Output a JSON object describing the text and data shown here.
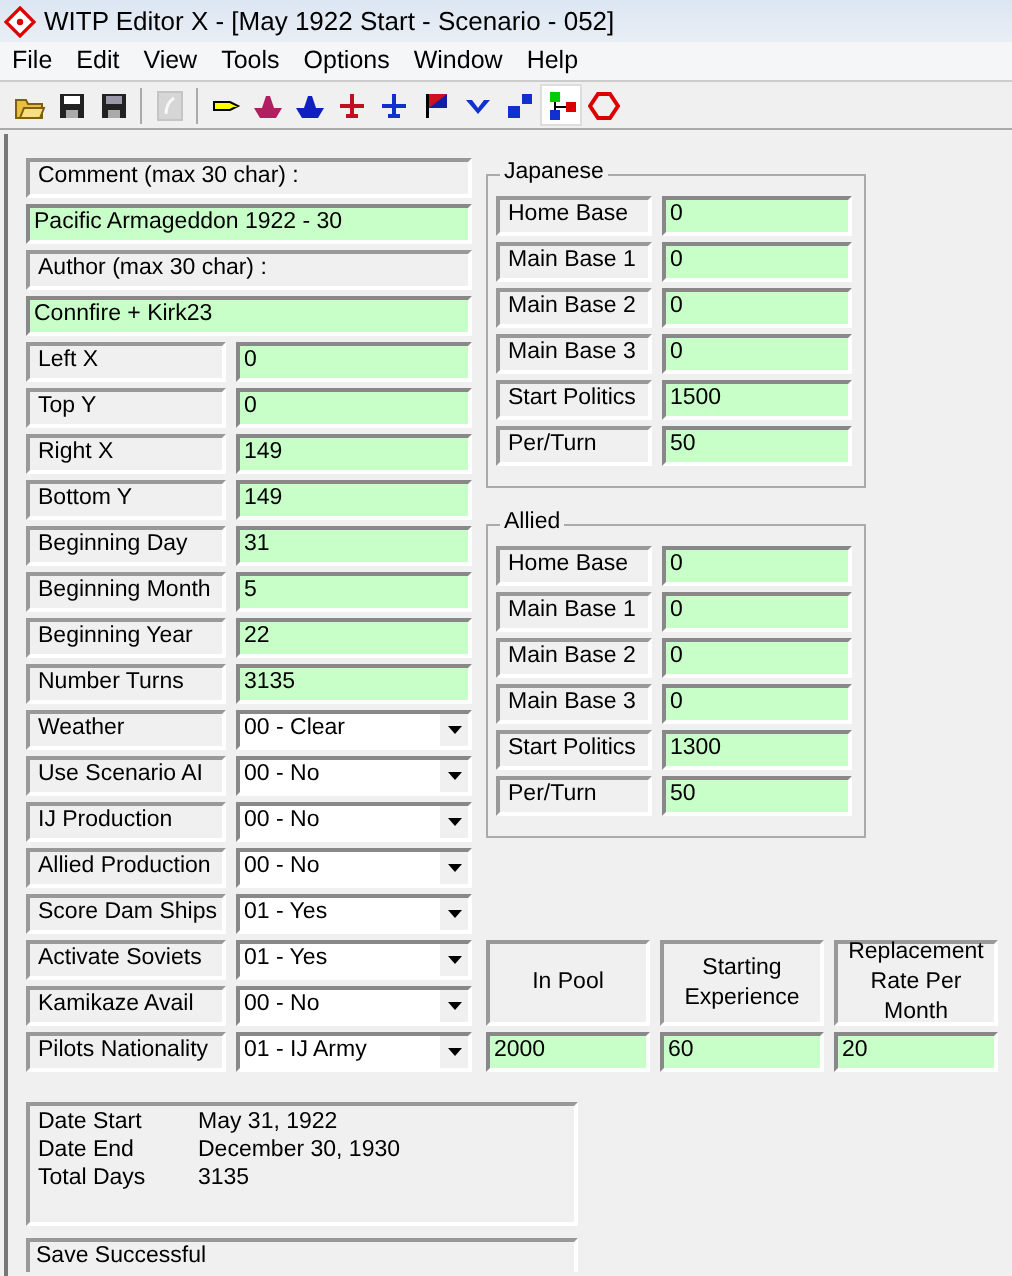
{
  "window": {
    "title": "WITP Editor X - [May 1922 Start - Scenario - 052]"
  },
  "menu": [
    "File",
    "Edit",
    "View",
    "Tools",
    "Options",
    "Window",
    "Help"
  ],
  "toolbar": [
    {
      "disabled": false,
      "pressed": false
    },
    {
      "disabled": false,
      "pressed": false
    },
    {
      "disabled": false,
      "pressed": false
    },
    {
      "disabled": true,
      "pressed": false
    },
    {
      "disabled": false,
      "pressed": false
    },
    {
      "disabled": false,
      "pressed": false
    },
    {
      "disabled": false,
      "pressed": false
    },
    {
      "disabled": false,
      "pressed": false
    },
    {
      "disabled": false,
      "pressed": false
    },
    {
      "disabled": false,
      "pressed": false
    },
    {
      "disabled": false,
      "pressed": false
    },
    {
      "disabled": false,
      "pressed": false
    },
    {
      "disabled": false,
      "pressed": true
    },
    {
      "disabled": false,
      "pressed": false
    }
  ],
  "comment": {
    "label": "Comment (max 30 char) :",
    "value": "Pacific Armageddon 1922 - 30"
  },
  "author": {
    "label": "Author (max 30 char) :",
    "value": "Connfire + Kirk23"
  },
  "fields": [
    {
      "label": "Left X",
      "value": "0"
    },
    {
      "label": "Top Y",
      "value": "0"
    },
    {
      "label": "Right X",
      "value": "149"
    },
    {
      "label": "Bottom Y",
      "value": "149"
    },
    {
      "label": "Beginning Day",
      "value": "31"
    },
    {
      "label": "Beginning Month",
      "value": "5"
    },
    {
      "label": "Beginning Year",
      "value": "22"
    },
    {
      "label": "Number Turns",
      "value": "3135"
    }
  ],
  "options": [
    {
      "label": "Weather",
      "value": "00 - Clear"
    },
    {
      "label": "Use Scenario AI",
      "value": "00 - No"
    },
    {
      "label": "IJ Production",
      "value": "00 - No"
    },
    {
      "label": "Allied Production",
      "value": "00 - No"
    },
    {
      "label": "Score Dam Ships",
      "value": "01 - Yes"
    },
    {
      "label": "Activate Soviets",
      "value": "01 - Yes"
    },
    {
      "label": "Kamikaze Avail",
      "value": "00 - No"
    },
    {
      "label": "Pilots Nationality",
      "value": "01 - IJ Army"
    }
  ],
  "sides": [
    {
      "title": "Japanese",
      "rows": [
        {
          "label": "Home Base",
          "value": "0"
        },
        {
          "label": "Main Base 1",
          "value": "0"
        },
        {
          "label": "Main Base 2",
          "value": "0"
        },
        {
          "label": "Main Base 3",
          "value": "0"
        },
        {
          "label": "Start Politics",
          "value": "1500"
        },
        {
          "label": "Per/Turn",
          "value": "50"
        }
      ]
    },
    {
      "title": "Allied",
      "rows": [
        {
          "label": "Home Base",
          "value": "0"
        },
        {
          "label": "Main Base 1",
          "value": "0"
        },
        {
          "label": "Main Base 2",
          "value": "0"
        },
        {
          "label": "Main Base 3",
          "value": "0"
        },
        {
          "label": "Start Politics",
          "value": "1300"
        },
        {
          "label": "Per/Turn",
          "value": "50"
        }
      ]
    }
  ],
  "pilot_pool": [
    {
      "heading": "In Pool",
      "value": "2000"
    },
    {
      "heading": "Starting Experience",
      "value": "60"
    },
    {
      "heading": "Replacement Rate Per Month",
      "value": "20"
    }
  ],
  "summary": [
    {
      "label": "Date Start",
      "value": "May 31, 1922"
    },
    {
      "label": "Date End",
      "value": "December 30, 1930"
    },
    {
      "label": "Total Days",
      "value": "3135"
    }
  ],
  "status": "Save Successful"
}
